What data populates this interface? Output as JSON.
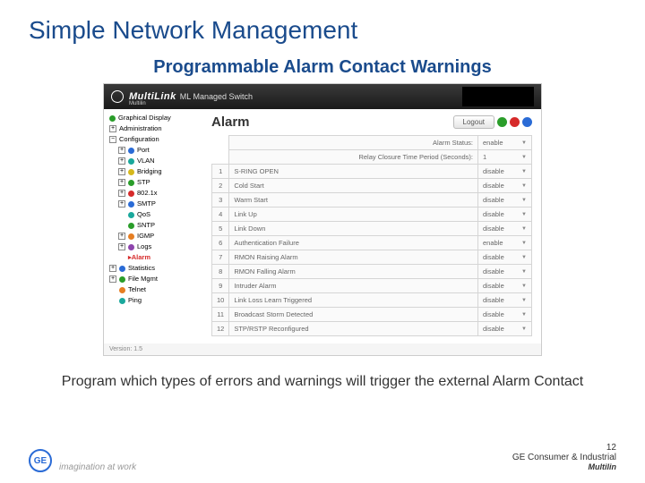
{
  "slide": {
    "title": "Simple Network Management",
    "subtitle": "Programmable Alarm Contact Warnings",
    "caption": "Program which types of errors and warnings will trigger the external Alarm Contact"
  },
  "banner": {
    "brand": "MultiLink",
    "product": "ML Managed Switch",
    "sub": "Multilin"
  },
  "tree": {
    "graphical": "Graphical Display",
    "admin": "Administration",
    "config": "Configuration",
    "items": [
      "Port",
      "VLAN",
      "Bridging",
      "STP",
      "802.1x",
      "SMTP",
      "QoS",
      "SNTP",
      "IGMP",
      "Logs"
    ],
    "alarm": "Alarm",
    "stats": "Statistics",
    "filemgmt": "File Mgmt",
    "telnet": "Telnet",
    "ping": "Ping"
  },
  "main": {
    "title": "Alarm",
    "logout": "Logout",
    "status_label": "Alarm Status:",
    "status_value": "enable",
    "period_label": "Relay Closure Time Period (Seconds):",
    "period_value": "1",
    "rows": [
      {
        "n": "1",
        "name": "S-RING OPEN",
        "v": "disable"
      },
      {
        "n": "2",
        "name": "Cold Start",
        "v": "disable"
      },
      {
        "n": "3",
        "name": "Warm Start",
        "v": "disable"
      },
      {
        "n": "4",
        "name": "Link Up",
        "v": "disable"
      },
      {
        "n": "5",
        "name": "Link Down",
        "v": "disable"
      },
      {
        "n": "6",
        "name": "Authentication Failure",
        "v": "enable"
      },
      {
        "n": "7",
        "name": "RMON Raising Alarm",
        "v": "disable"
      },
      {
        "n": "8",
        "name": "RMON Falling Alarm",
        "v": "disable"
      },
      {
        "n": "9",
        "name": "Intruder Alarm",
        "v": "disable"
      },
      {
        "n": "10",
        "name": "Link Loss Learn Triggered",
        "v": "disable"
      },
      {
        "n": "11",
        "name": "Broadcast Storm Detected",
        "v": "disable"
      },
      {
        "n": "12",
        "name": "STP/RSTP Reconfigured",
        "v": "disable"
      }
    ],
    "version": "Version: 1.5"
  },
  "footer": {
    "tag": "imagination at work",
    "page": "12",
    "org": "GE Consumer & Industrial",
    "prod": "Multilin"
  }
}
